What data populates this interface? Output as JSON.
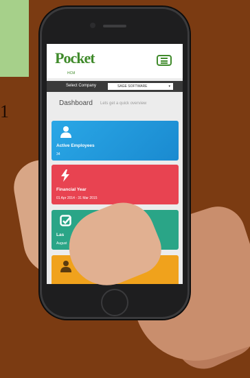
{
  "background_edge_text": "1",
  "app": {
    "logo_text": "Pocket",
    "logo_sub": "HCM"
  },
  "company_bar": {
    "label": "Select Company",
    "selected": "SAGE SOFTWARE",
    "caret": "▾"
  },
  "dashboard": {
    "title": "Dashboard",
    "subtitle": "Lets get a quick overview"
  },
  "cards": [
    {
      "icon": "user-icon",
      "title": "Active Employees",
      "value": "34",
      "color": "#2aa7e6"
    },
    {
      "icon": "bolt-icon",
      "title": "Financial Year",
      "value": "01 Apr 2014 - 31 Mar 2015",
      "color": "#e84351"
    },
    {
      "icon": "check-square-icon",
      "title": "Las",
      "value": "August",
      "color": "#2aa587"
    },
    {
      "icon": "user-icon",
      "title": "",
      "value": "",
      "color": "#f0a21c"
    }
  ]
}
